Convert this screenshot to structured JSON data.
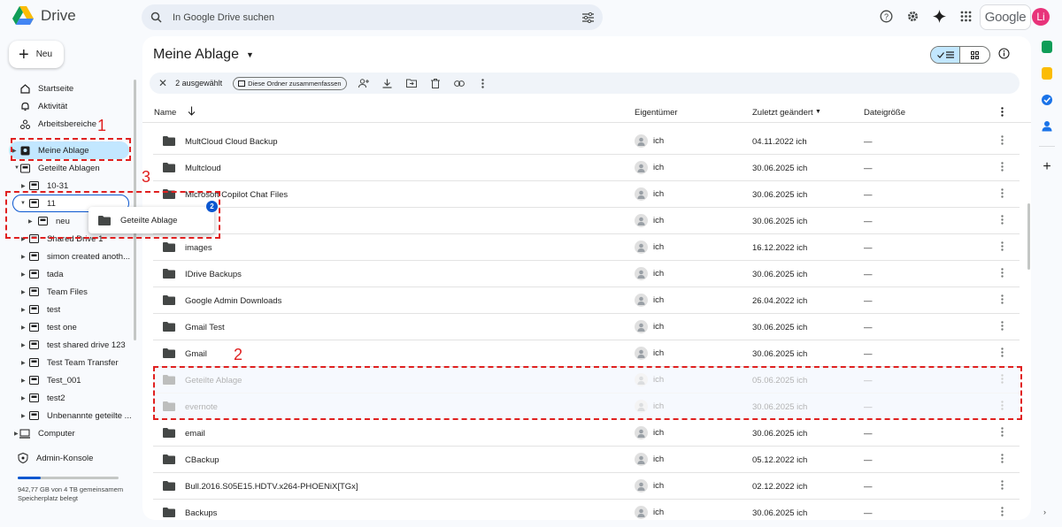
{
  "app": {
    "name": "Drive",
    "account_word": "Google",
    "avatar_letter": "Li"
  },
  "search": {
    "placeholder": "In Google Drive suchen"
  },
  "sidebar": {
    "new_label": "Neu",
    "top": [
      {
        "label": "Startseite",
        "icon": "home-icon"
      },
      {
        "label": "Aktivität",
        "icon": "bell-icon"
      },
      {
        "label": "Arbeitsbereiche",
        "icon": "workspaces-icon"
      }
    ],
    "my_drive": "Meine Ablage",
    "shared_drives": "Geteilte Ablagen",
    "drives": [
      "10-31",
      "11",
      "neu",
      "Shared Drive 1",
      "simon created anoth...",
      "tada",
      "Team Files",
      "test",
      "test one",
      "test shared drive 123",
      "Test Team Transfer",
      "Test_001",
      "test2",
      "Unbenannte geteilte ..."
    ],
    "computer": "Computer",
    "admin": "Admin-Konsole",
    "storage": "942,77 GB von 4 TB gemeinsamem Speicherplatz belegt",
    "storage_used_fraction": 0.23
  },
  "drag": {
    "label": "Geteilte Ablage",
    "count": "2"
  },
  "main": {
    "title": "Meine Ablage",
    "toolbar": {
      "selected": "2 ausgewählt",
      "summarize": "Diese Ordner zusammenfassen"
    },
    "columns": {
      "name": "Name",
      "owner": "Eigentümer",
      "modified": "Zuletzt geändert",
      "size": "Dateigröße"
    },
    "rows": [
      {
        "name": "MultCloud Cloud Backup",
        "owner": "ich",
        "date": "04.11.2022 ich",
        "size": "—"
      },
      {
        "name": "Multcloud",
        "owner": "ich",
        "date": "30.06.2025 ich",
        "size": "—"
      },
      {
        "name": "Microsoft Copilot Chat Files",
        "owner": "ich",
        "date": "30.06.2025 ich",
        "size": "—"
      },
      {
        "name": "",
        "owner": "ich",
        "date": "30.06.2025 ich",
        "size": "—"
      },
      {
        "name": "images",
        "owner": "ich",
        "date": "16.12.2022 ich",
        "size": "—"
      },
      {
        "name": "IDrive Backups",
        "owner": "ich",
        "date": "30.06.2025 ich",
        "size": "—"
      },
      {
        "name": "Google Admin Downloads",
        "owner": "ich",
        "date": "26.04.2022 ich",
        "size": "—"
      },
      {
        "name": "Gmail Test",
        "owner": "ich",
        "date": "30.06.2025 ich",
        "size": "—"
      },
      {
        "name": "Gmail",
        "owner": "ich",
        "date": "30.06.2025 ich",
        "size": "—"
      },
      {
        "name": "Geteilte Ablage",
        "owner": "ich",
        "date": "05.06.2025 ich",
        "size": "—",
        "faded": true
      },
      {
        "name": "evernote",
        "owner": "ich",
        "date": "30.06.2025 ich",
        "size": "—",
        "faded": true
      },
      {
        "name": "email",
        "owner": "ich",
        "date": "30.06.2025 ich",
        "size": "—"
      },
      {
        "name": "CBackup",
        "owner": "ich",
        "date": "05.12.2022 ich",
        "size": "—"
      },
      {
        "name": "Bull.2016.S05E15.HDTV.x264-PHOENiX[TGx]",
        "owner": "ich",
        "date": "02.12.2022 ich",
        "size": "—"
      },
      {
        "name": "Backups",
        "owner": "ich",
        "date": "30.06.2025 ich",
        "size": "—"
      }
    ]
  },
  "annotations": {
    "n1": "1",
    "n2": "2",
    "n3": "3"
  },
  "colors": {
    "accent": "#0b57d0",
    "selected": "#c2e7ff",
    "annotation": "#e02020"
  }
}
